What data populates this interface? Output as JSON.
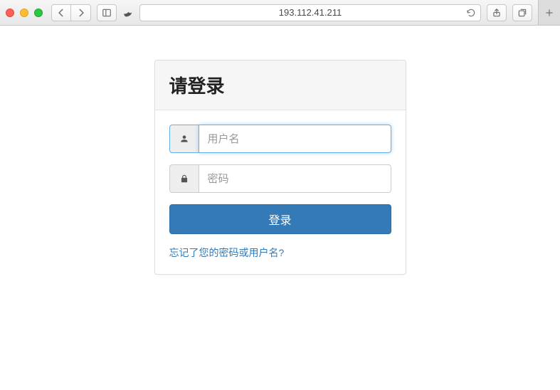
{
  "browser": {
    "url": "193.112.41.211"
  },
  "login": {
    "title": "请登录",
    "username": {
      "placeholder": "用户名",
      "value": ""
    },
    "password": {
      "placeholder": "密码",
      "value": ""
    },
    "submit_label": "登录",
    "forgot_label": "忘记了您的密码或用户名?"
  }
}
